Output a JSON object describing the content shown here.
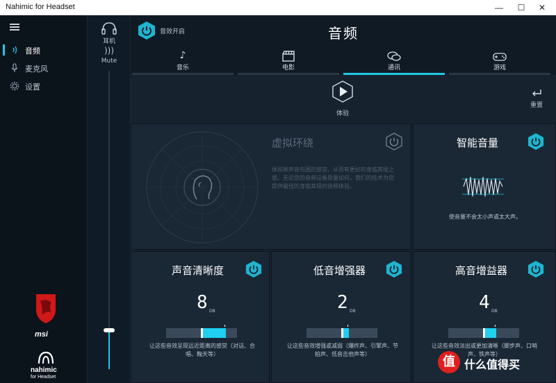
{
  "window": {
    "title": "Nahimic for Headset",
    "minimize_glyph": "—",
    "maximize_glyph": "☐",
    "close_glyph": "✕"
  },
  "sidebar": {
    "items": [
      {
        "label": "音频",
        "icon": "audio-wave-icon",
        "active": true
      },
      {
        "label": "麦克风",
        "icon": "microphone-icon",
        "active": false
      },
      {
        "label": "设置",
        "icon": "gear-icon",
        "active": false
      }
    ],
    "brand_msi": "msi",
    "brand_nahimic": "nahimic",
    "brand_nahimic_sub": "for Headset"
  },
  "device": {
    "label": "耳机",
    "mute_label": "Mute",
    "volume_fraction": 0.13
  },
  "header": {
    "fx_label": "音效开启",
    "title": "音频"
  },
  "tabs": [
    {
      "label": "音乐",
      "icon": "music-note-icon",
      "active": false
    },
    {
      "label": "电影",
      "icon": "clapperboard-icon",
      "active": false
    },
    {
      "label": "通讯",
      "icon": "chat-bubbles-icon",
      "active": true
    },
    {
      "label": "游戏",
      "icon": "gamepad-icon",
      "active": false
    }
  ],
  "play": {
    "label": "体验"
  },
  "reset": {
    "label": "重置"
  },
  "surround": {
    "title": "虚拟环绕",
    "desc": "体验被声音包围的感觉，从而有更好的身临其境之感。无论您的音频设备质量如何，我们的技术为您提供最佳的身临其境的音频体验。"
  },
  "smart_volume": {
    "title": "智能音量",
    "desc": "使音量不会太小声或太大声。"
  },
  "clarity": {
    "title": "声音清晰度",
    "value": "8",
    "unit": "DB",
    "fill_from": 0.5,
    "fill_to": 0.84,
    "desc": "让这些音效呈现远近距离的感觉（对话、合唱、鞠天等）"
  },
  "bass": {
    "title": "低音增强器",
    "value": "2",
    "unit": "DB",
    "fill_from": 0.5,
    "fill_to": 0.6,
    "desc": "让这些音效增强或减弱（爆炸声、引擎声、节拍声、低音吉他声等）"
  },
  "treble": {
    "title": "高音增益器",
    "value": "4",
    "unit": "DB",
    "fill_from": 0.5,
    "fill_to": 0.68,
    "desc": "让这些音效淡出或更加清晰（脚步声、口哨声、铁声等）"
  },
  "watermark": {
    "mark": "值",
    "text": "什么值得买"
  },
  "colors": {
    "accent": "#22c8e6",
    "background": "#16222e",
    "sidebar": "#0b131b"
  }
}
